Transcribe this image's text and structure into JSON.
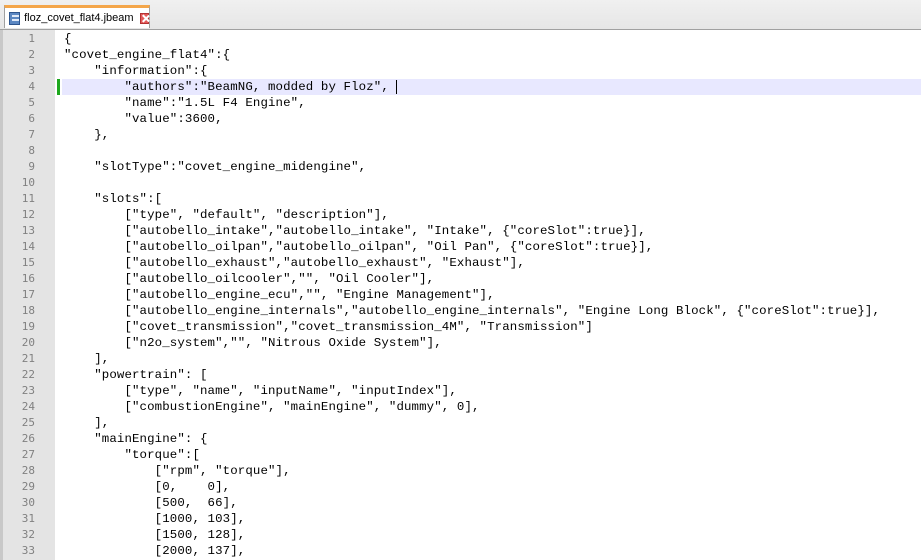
{
  "tab": {
    "filename": "floz_covet_flat4.jbeam"
  },
  "editor": {
    "current_line": 4,
    "lines": [
      {
        "n": "1",
        "t": "{"
      },
      {
        "n": "2",
        "t": "\"covet_engine_flat4\":{"
      },
      {
        "n": "3",
        "t": "    \"information\":{"
      },
      {
        "n": "4",
        "t": "        \"authors\":\"BeamNG, modded by Floz\","
      },
      {
        "n": "5",
        "t": "        \"name\":\"1.5L F4 Engine\","
      },
      {
        "n": "6",
        "t": "        \"value\":3600,"
      },
      {
        "n": "7",
        "t": "    },"
      },
      {
        "n": "8",
        "t": ""
      },
      {
        "n": "9",
        "t": "    \"slotType\":\"covet_engine_midengine\","
      },
      {
        "n": "10",
        "t": ""
      },
      {
        "n": "11",
        "t": "    \"slots\":["
      },
      {
        "n": "12",
        "t": "        [\"type\", \"default\", \"description\"],"
      },
      {
        "n": "13",
        "t": "        [\"autobello_intake\",\"autobello_intake\", \"Intake\", {\"coreSlot\":true}],"
      },
      {
        "n": "14",
        "t": "        [\"autobello_oilpan\",\"autobello_oilpan\", \"Oil Pan\", {\"coreSlot\":true}],"
      },
      {
        "n": "15",
        "t": "        [\"autobello_exhaust\",\"autobello_exhaust\", \"Exhaust\"],"
      },
      {
        "n": "16",
        "t": "        [\"autobello_oilcooler\",\"\", \"Oil Cooler\"],"
      },
      {
        "n": "17",
        "t": "        [\"autobello_engine_ecu\",\"\", \"Engine Management\"],"
      },
      {
        "n": "18",
        "t": "        [\"autobello_engine_internals\",\"autobello_engine_internals\", \"Engine Long Block\", {\"coreSlot\":true}],"
      },
      {
        "n": "19",
        "t": "        [\"covet_transmission\",\"covet_transmission_4M\", \"Transmission\"]"
      },
      {
        "n": "20",
        "t": "        [\"n2o_system\",\"\", \"Nitrous Oxide System\"],"
      },
      {
        "n": "21",
        "t": "    ],"
      },
      {
        "n": "22",
        "t": "    \"powertrain\": ["
      },
      {
        "n": "23",
        "t": "        [\"type\", \"name\", \"inputName\", \"inputIndex\"],"
      },
      {
        "n": "24",
        "t": "        [\"combustionEngine\", \"mainEngine\", \"dummy\", 0],"
      },
      {
        "n": "25",
        "t": "    ],"
      },
      {
        "n": "26",
        "t": "    \"mainEngine\": {"
      },
      {
        "n": "27",
        "t": "        \"torque\":["
      },
      {
        "n": "28",
        "t": "            [\"rpm\", \"torque\"],"
      },
      {
        "n": "29",
        "t": "            [0,    0],"
      },
      {
        "n": "30",
        "t": "            [500,  66],"
      },
      {
        "n": "31",
        "t": "            [1000, 103],"
      },
      {
        "n": "32",
        "t": "            [1500, 128],"
      },
      {
        "n": "33",
        "t": "            [2000, 137],"
      }
    ]
  }
}
